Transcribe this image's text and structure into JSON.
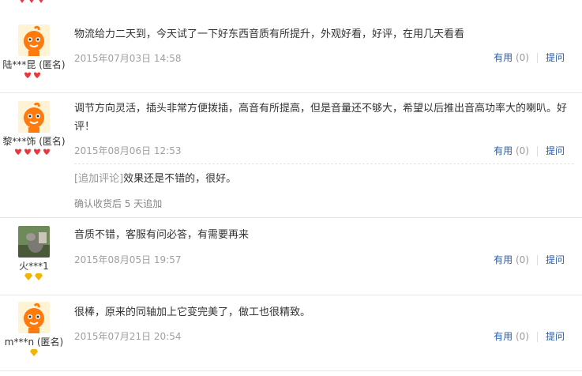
{
  "reviews": [
    {
      "user": "陆***昆 (匿名)",
      "avatar": "orange-mascot",
      "badge_type": "heart",
      "badge_count": 2,
      "text": "物流给力二天到，今天试了一下好东西音质有所提升，外观好看，好评，在用几天看看",
      "date": "2015年07月03日 14:58",
      "useful_label": "有用",
      "useful_count": "(0)",
      "ask_label": "提问"
    },
    {
      "user": "黎***饰 (匿名)",
      "avatar": "orange-mascot",
      "badge_type": "heart",
      "badge_count": 4,
      "text": "调节方向灵活，插头非常方便拨插，高音有所提高，但是音量还不够大，希望以后推出音高功率大的喇叭。好评！",
      "date": "2015年08月06日 12:53",
      "useful_label": "有用",
      "useful_count": "(0)",
      "ask_label": "提问",
      "append_tag": "[追加评论]",
      "append_text": "效果还是不错的，很好。",
      "append_note": "确认收货后 5 天追加"
    },
    {
      "user": "火***1",
      "avatar": "photo",
      "badge_type": "diamond",
      "badge_count": 2,
      "text": "音质不错，客服有问必答，有需要再来",
      "date": "2015年08月05日 19:57",
      "useful_label": "有用",
      "useful_count": "(0)",
      "ask_label": "提问"
    },
    {
      "user": "m***n (匿名)",
      "avatar": "orange-mascot",
      "badge_type": "diamond",
      "badge_count": 1,
      "text": "很棒，原来的同轴加上它变完美了，做工也很精致。",
      "date": "2015年07月21日 20:54",
      "useful_label": "有用",
      "useful_count": "(0)",
      "ask_label": "提问"
    }
  ],
  "colors": {
    "link": "#2a5caa",
    "meta": "#a0a0a0",
    "heart": "#e8383d",
    "diamond": "#f2b400",
    "mascot": "#ff7a0c"
  }
}
